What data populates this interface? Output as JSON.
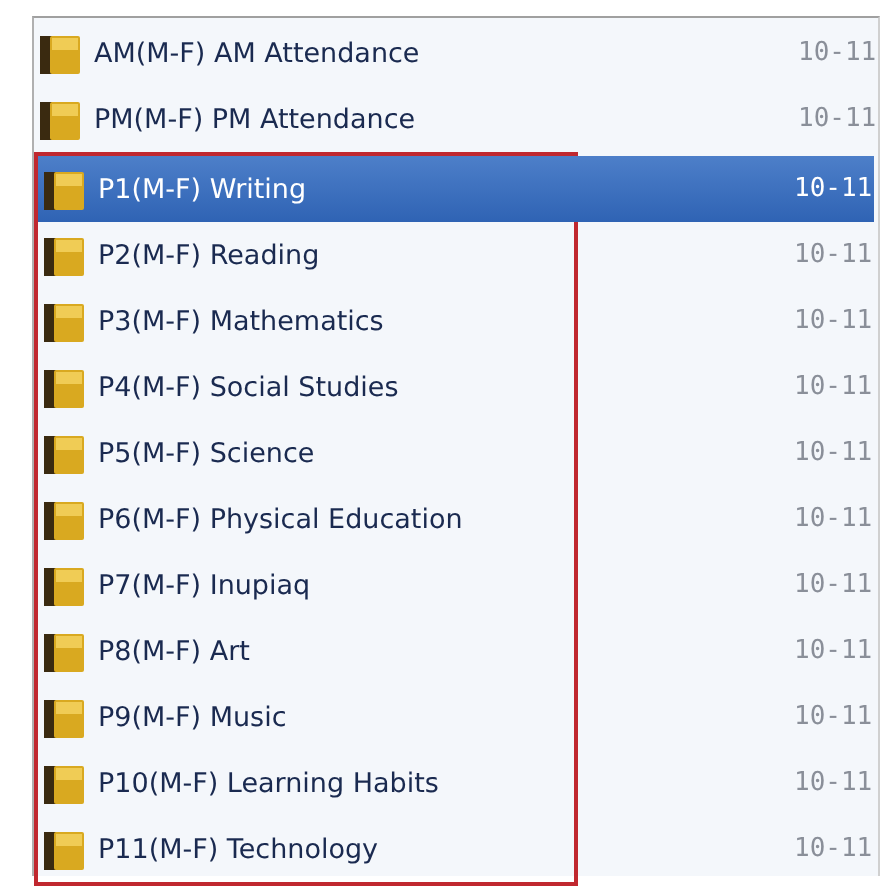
{
  "items": [
    {
      "label": "AM(M-F) AM Attendance",
      "date": "10-11",
      "selected": false
    },
    {
      "label": "PM(M-F) PM Attendance",
      "date": "10-11",
      "selected": false
    }
  ],
  "highlighted_group": {
    "items": [
      {
        "label": "P1(M-F) Writing",
        "date": "10-11",
        "selected": true
      },
      {
        "label": "P2(M-F) Reading",
        "date": "10-11",
        "selected": false
      },
      {
        "label": "P3(M-F) Mathematics",
        "date": "10-11",
        "selected": false
      },
      {
        "label": "P4(M-F) Social Studies",
        "date": "10-11",
        "selected": false
      },
      {
        "label": "P5(M-F) Science",
        "date": "10-11",
        "selected": false
      },
      {
        "label": "P6(M-F) Physical Education",
        "date": "10-11",
        "selected": false
      },
      {
        "label": "P7(M-F) Inupiaq",
        "date": "10-11",
        "selected": false
      },
      {
        "label": "P8(M-F) Art",
        "date": "10-11",
        "selected": false
      },
      {
        "label": "P9(M-F) Music",
        "date": "10-11",
        "selected": false
      },
      {
        "label": "P10(M-F) Learning Habits",
        "date": "10-11",
        "selected": false
      },
      {
        "label": "P11(M-F) Technology",
        "date": "10-11",
        "selected": false
      }
    ]
  }
}
